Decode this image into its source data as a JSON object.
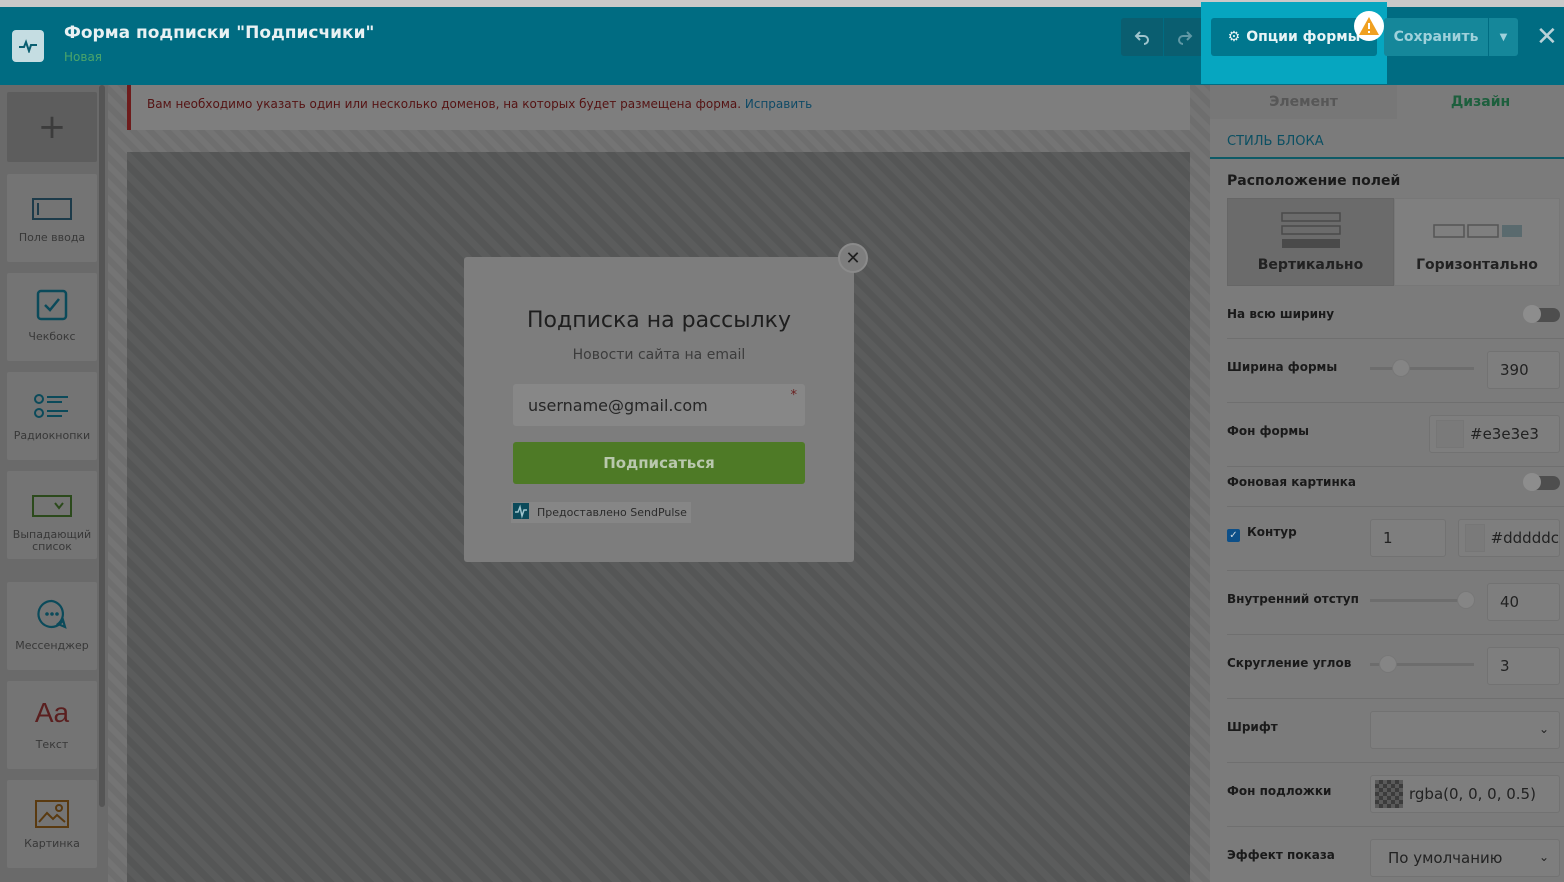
{
  "header": {
    "title": "Форма подписки \"Подписчики\"",
    "subtitle": "Новая",
    "options_label": "Опции формы",
    "save_label": "Сохранить"
  },
  "toolbar": {
    "add_label": "+",
    "items": [
      {
        "label": "Поле ввода",
        "icon": "input-field-icon"
      },
      {
        "label": "Чекбокс",
        "icon": "checkbox-icon"
      },
      {
        "label": "Радиокнопки",
        "icon": "radio-icon"
      },
      {
        "label": "Выпадающий список",
        "icon": "dropdown-icon"
      },
      {
        "label": "Мессенджер",
        "icon": "messenger-icon"
      },
      {
        "label": "Текст",
        "icon": "text-icon",
        "glyph": "Aa"
      },
      {
        "label": "Картинка",
        "icon": "image-icon"
      }
    ]
  },
  "notice": {
    "text": "Вам необходимо указать один или несколько доменов, на которых будет размещена форма.",
    "link": "Исправить"
  },
  "popup": {
    "title": "Подписка на рассылку",
    "subtitle": "Новости сайта на email",
    "email_value": "username@gmail.com",
    "required_mark": "*",
    "submit_label": "Подписаться",
    "brand_label": "Предоставлено SendPulse"
  },
  "panel": {
    "tabs": [
      "Элемент",
      "Дизайн"
    ],
    "section_title": "СТИЛЬ БЛОКА",
    "layout_title": "Расположение полей",
    "layout_vertical": "Вертикально",
    "layout_horizontal": "Горизонтально",
    "full_width_label": "На всю ширину",
    "form_width_label": "Ширина формы",
    "form_width_value": "390",
    "form_bg_label": "Фон формы",
    "form_bg_value": "#e3e3e3",
    "bg_image_label": "Фоновая картинка",
    "border_label": "Контур",
    "border_width_value": "1",
    "border_color_value": "#dddddc",
    "padding_label": "Внутренний отступ",
    "padding_value": "40",
    "radius_label": "Скругление углов",
    "radius_value": "3",
    "font_label": "Шрифт",
    "font_value": "",
    "overlay_label": "Фон подложки",
    "overlay_value": "rgba(0, 0, 0, 0.5)",
    "effect_label": "Эффект показа",
    "effect_value": "По умолчанию"
  },
  "colors": {
    "header": "#006c82",
    "highlight": "#06a6c0",
    "warning": "#f0a020",
    "submit": "#6aaa2c"
  }
}
